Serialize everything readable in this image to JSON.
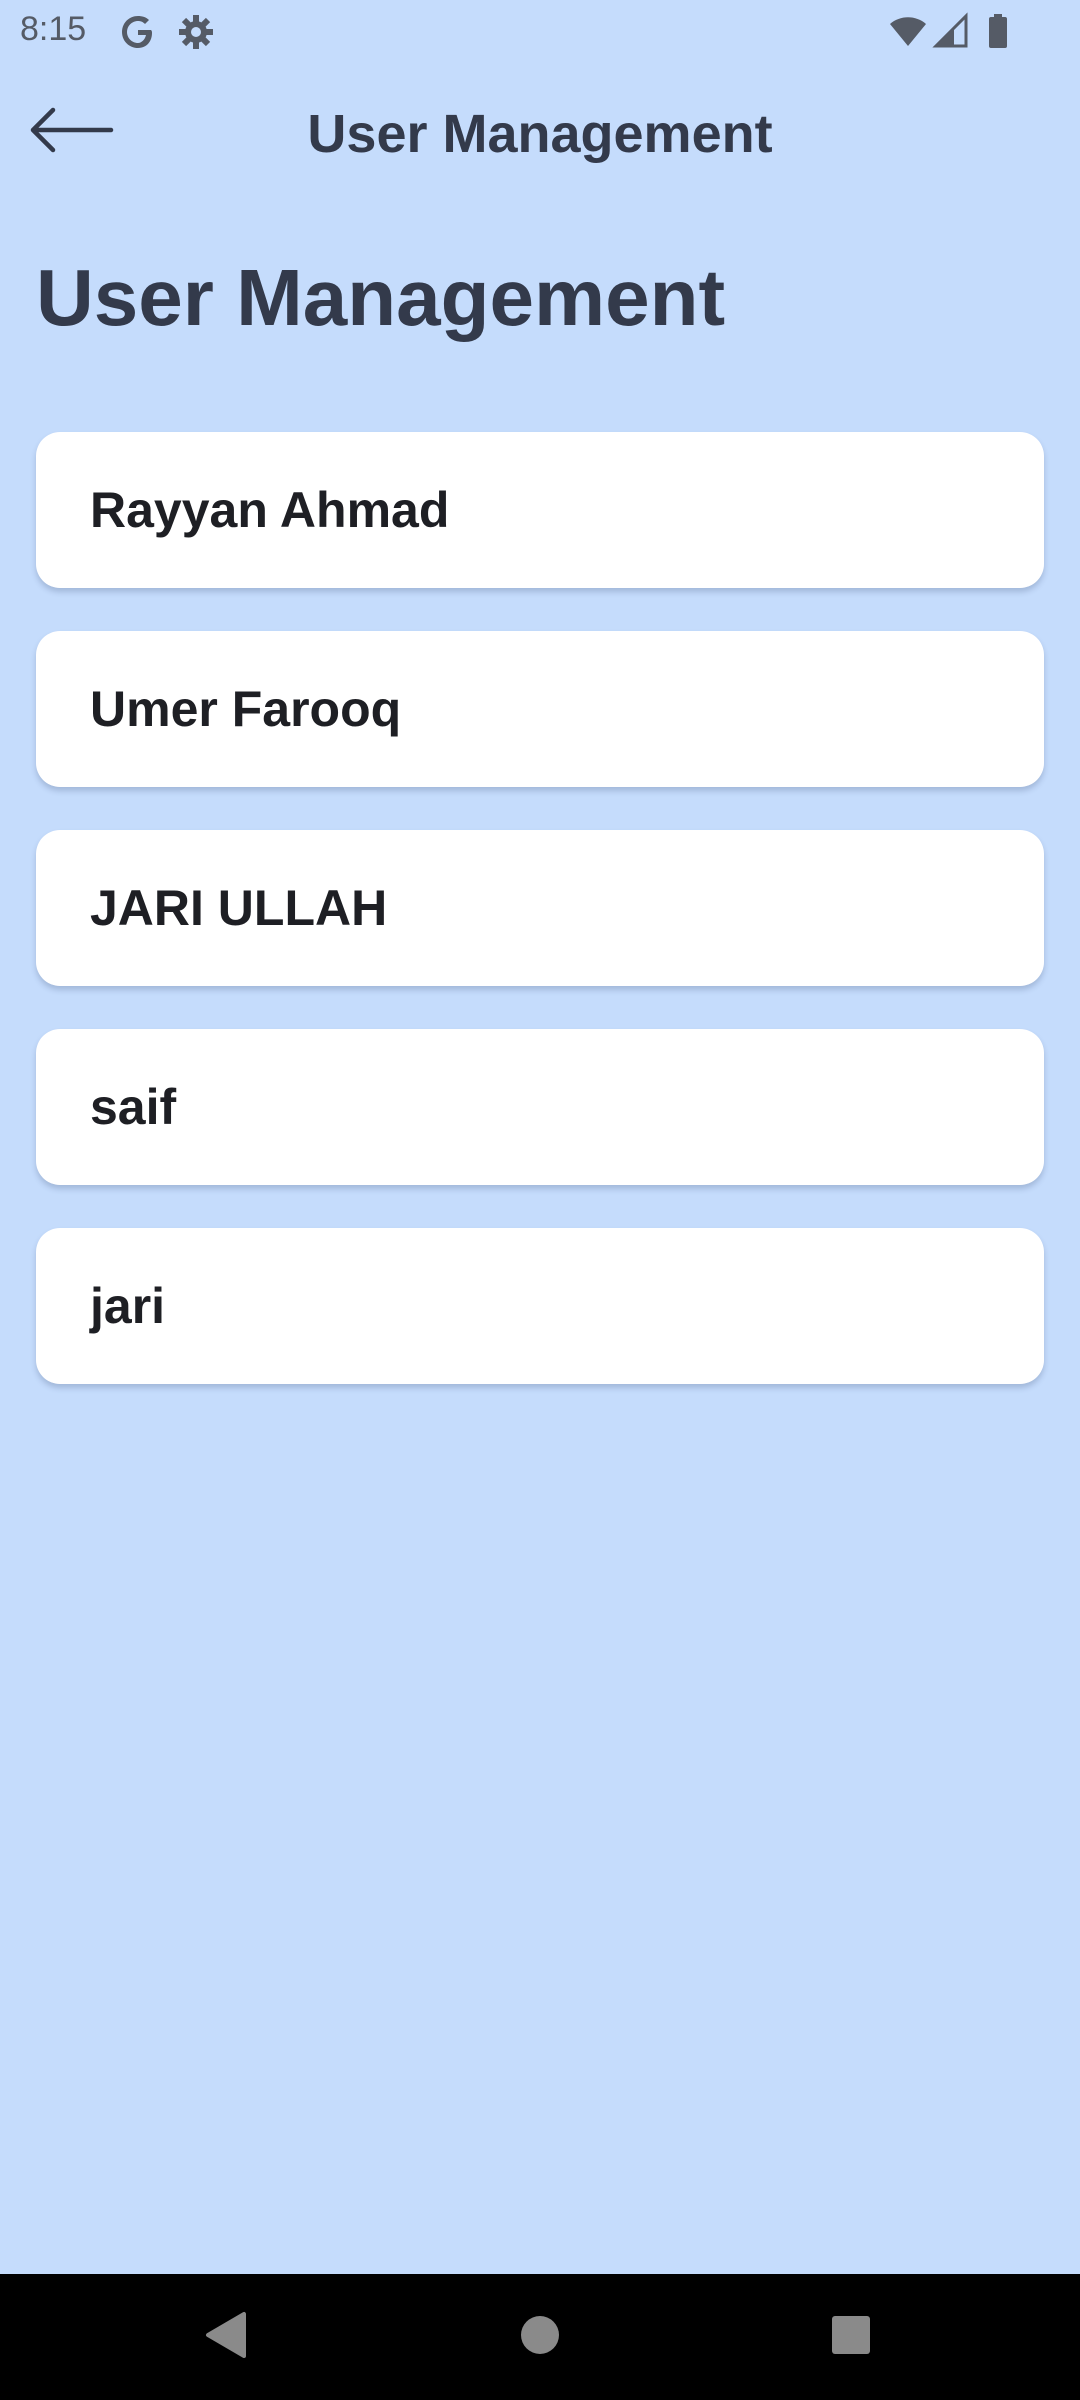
{
  "status_bar": {
    "time": "8:15",
    "icons": [
      "google-icon",
      "settings-icon",
      "wifi-icon",
      "signal-icon",
      "battery-icon"
    ]
  },
  "app_bar": {
    "back_icon": "arrow-back-icon",
    "title": "User Management"
  },
  "page": {
    "heading": "User Management",
    "users": [
      {
        "name": "Rayyan Ahmad"
      },
      {
        "name": "Umer Farooq"
      },
      {
        "name": "JARI ULLAH"
      },
      {
        "name": "saif"
      },
      {
        "name": "jari"
      }
    ]
  },
  "nav_bar": {
    "buttons": [
      "back-triangle-icon",
      "home-circle-icon",
      "recents-square-icon"
    ]
  },
  "colors": {
    "background": "#c5dcfc",
    "card": "#ffffff",
    "title_text": "#333a4b",
    "name_text": "#1e1f24",
    "nav_bar": "#000000"
  }
}
